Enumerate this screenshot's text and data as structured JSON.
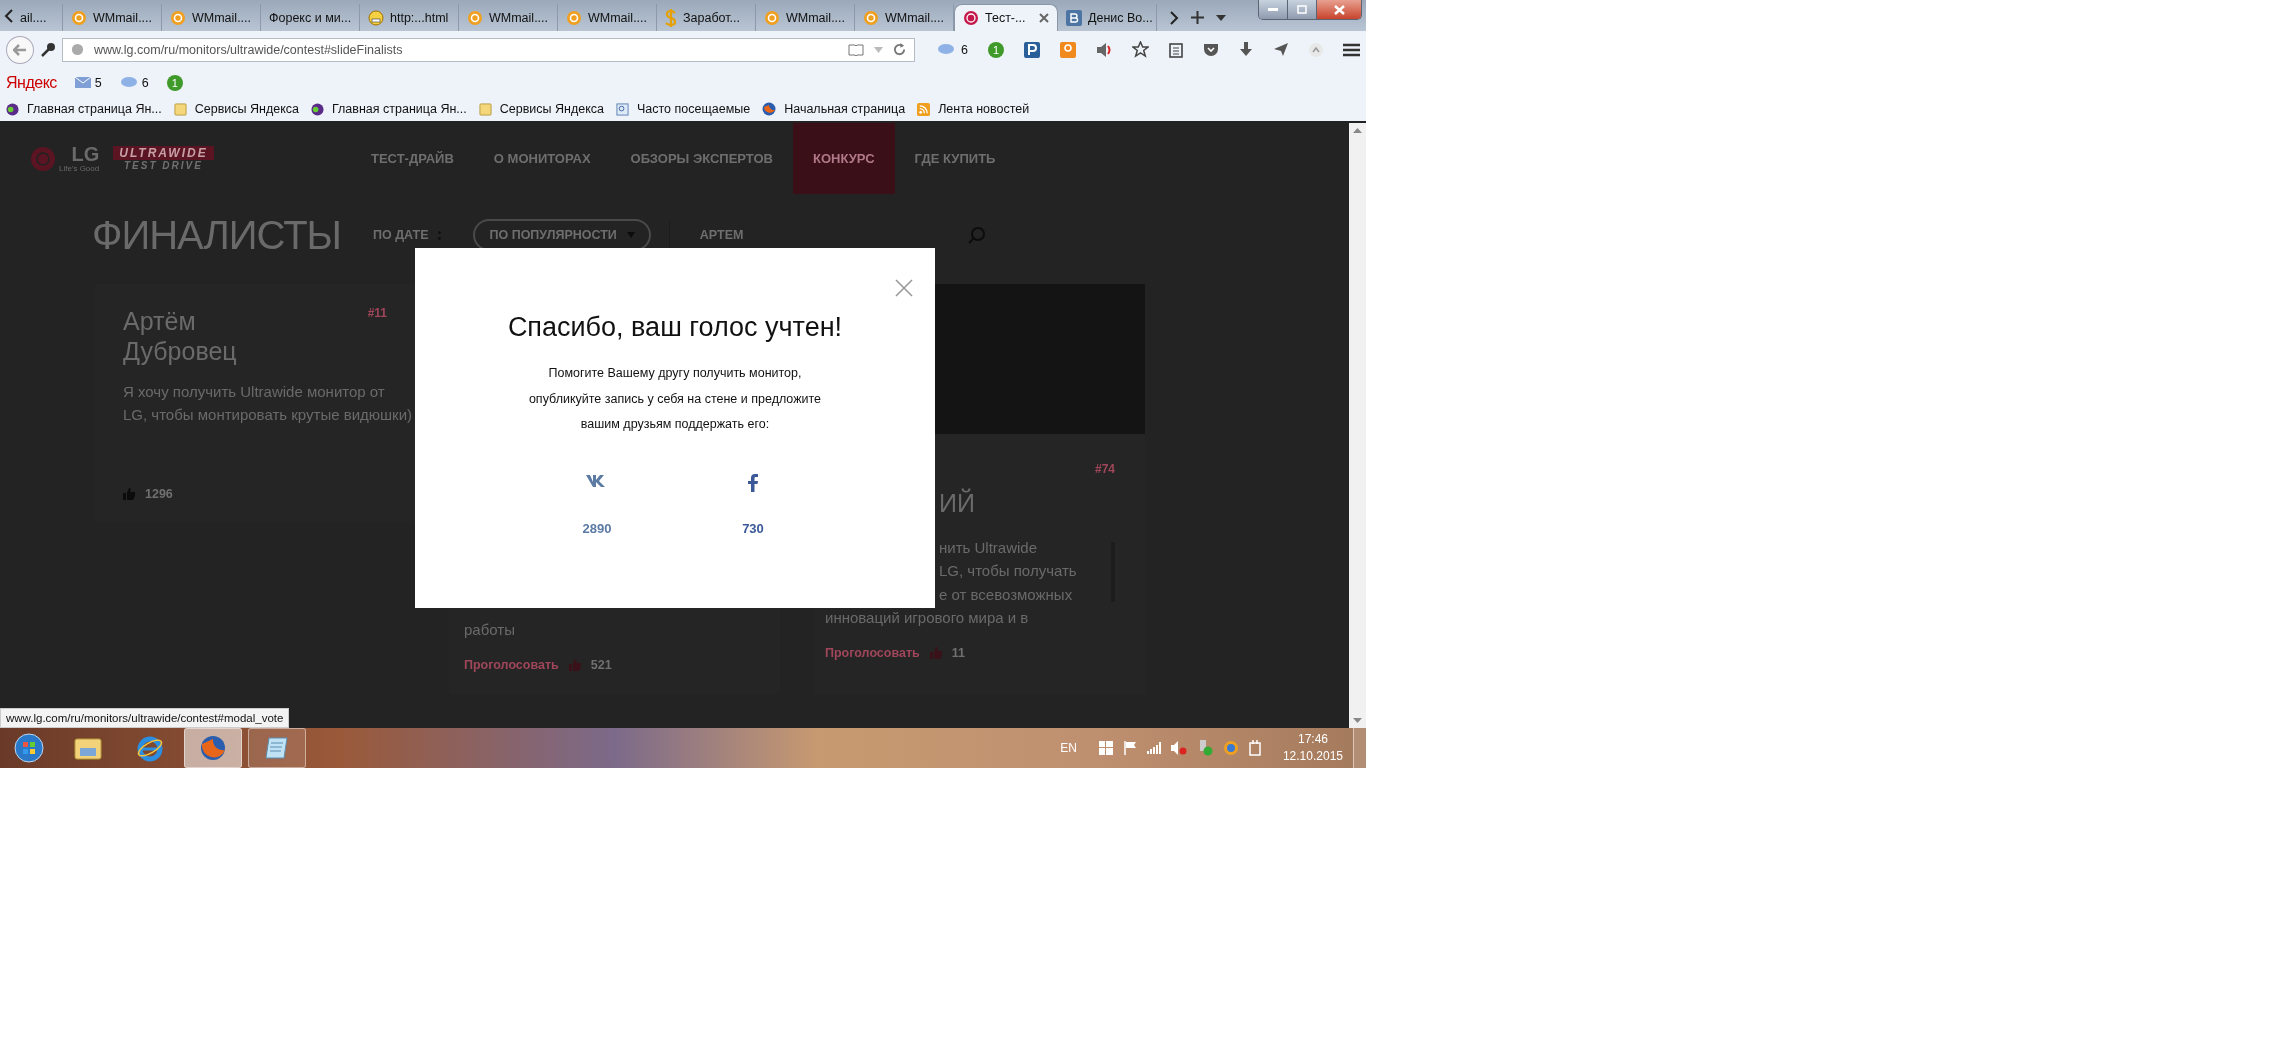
{
  "browser": {
    "tabs": [
      {
        "title": "ail....",
        "kind": "plain",
        "selected": false
      },
      {
        "title": "WMmail....",
        "kind": "mail",
        "selected": false
      },
      {
        "title": "WMmail....",
        "kind": "mail",
        "selected": false
      },
      {
        "title": "Форекс и ми...",
        "kind": "plain",
        "selected": false
      },
      {
        "title": "http:...html",
        "kind": "emoji",
        "selected": false
      },
      {
        "title": "WMmail....",
        "kind": "mail",
        "selected": false
      },
      {
        "title": "WMmail....",
        "kind": "mail",
        "selected": false
      },
      {
        "title": "Заработ...",
        "kind": "dollar",
        "selected": false
      },
      {
        "title": "WMmail....",
        "kind": "mail",
        "selected": false
      },
      {
        "title": "WMmail....",
        "kind": "mail",
        "selected": false
      },
      {
        "title": "Тест-...",
        "kind": "lg",
        "selected": true
      },
      {
        "title": "Денис Во...",
        "kind": "vk",
        "selected": false
      }
    ],
    "url": "www.lg.com/ru/monitors/ultrawide/contest#slideFinalists",
    "toolbar_weather": "6",
    "toolbar_badge": "1",
    "yandex_bar": {
      "logo": "Яндекс",
      "mail_count": "5",
      "weather": "6",
      "badge": "1"
    },
    "bookmarks": [
      {
        "label": "Главная страница Ян...",
        "kind": "yandex"
      },
      {
        "label": "Сервисы Яндекса",
        "kind": "folder"
      },
      {
        "label": "Главная страница Ян...",
        "kind": "yandex"
      },
      {
        "label": "Сервисы Яндекса",
        "kind": "folder"
      },
      {
        "label": "Часто посещаемые",
        "kind": "smart"
      },
      {
        "label": "Начальная страница",
        "kind": "firefox"
      },
      {
        "label": "Лента новостей",
        "kind": "feed"
      }
    ],
    "status_link": "www.lg.com/ru/monitors/ultrawide/contest#modal_vote"
  },
  "site": {
    "logo": {
      "brand": "LG",
      "slogan": "Life's Good",
      "product": "ULTRAWIDE",
      "subtitle": "TEST DRIVE"
    },
    "nav": [
      {
        "label": "ТЕСТ-ДРАЙВ",
        "selected": false
      },
      {
        "label": "О МОНИТОРАХ",
        "selected": false
      },
      {
        "label": "ОБЗОРЫ ЭКСПЕРТОВ",
        "selected": false
      },
      {
        "label": "КОНКУРС",
        "selected": true
      },
      {
        "label": "ГДЕ КУПИТЬ",
        "selected": false
      }
    ],
    "heading": "ФИНАЛИСТЫ",
    "sort_options": [
      {
        "label": "ПО ДАТЕ",
        "selected": false
      },
      {
        "label": "ПО ПОПУЛЯРНОСТИ",
        "selected": true
      }
    ],
    "search_value": "АРТЕМ",
    "cards": [
      {
        "kind": "text",
        "rank": "#11",
        "name": "Артём Дубровец",
        "text": "Я хочу получить Ultrawide монитор от LG, чтобы монтировать крутые видюшки)",
        "likes": "1296"
      },
      {
        "kind": "covered",
        "last_line": "работы",
        "vote_label": "Проголосовать",
        "likes": "521"
      },
      {
        "kind": "photo",
        "rank": "#74",
        "name_fragment": "ИЙ",
        "visible_lines": [
          "нить Ultrawide",
          "LG, чтобы получать",
          "е от всевозможных"
        ],
        "last_line": "инноваций игрового мира и в",
        "vote_label": "Проголосовать",
        "likes": "11"
      }
    ]
  },
  "modal": {
    "title": "Спасибо, ваш голос учтен!",
    "text": "Помогите Вашему другу получить монитор, опубликуйте запись у себя на стене и предложите вашим друзьям поддержать его:",
    "shares": [
      {
        "kind": "vk",
        "count": "2890"
      },
      {
        "kind": "facebook",
        "count": "730"
      }
    ]
  },
  "taskbar": {
    "apps": [
      {
        "kind": "explorer",
        "running": false,
        "selected": false
      },
      {
        "kind": "ie",
        "running": false,
        "selected": false
      },
      {
        "kind": "firefox",
        "running": true,
        "selected": true
      },
      {
        "kind": "notepad",
        "running": true,
        "selected": false
      }
    ],
    "language": "EN",
    "time": "17:46",
    "date": "12.10.2015"
  }
}
